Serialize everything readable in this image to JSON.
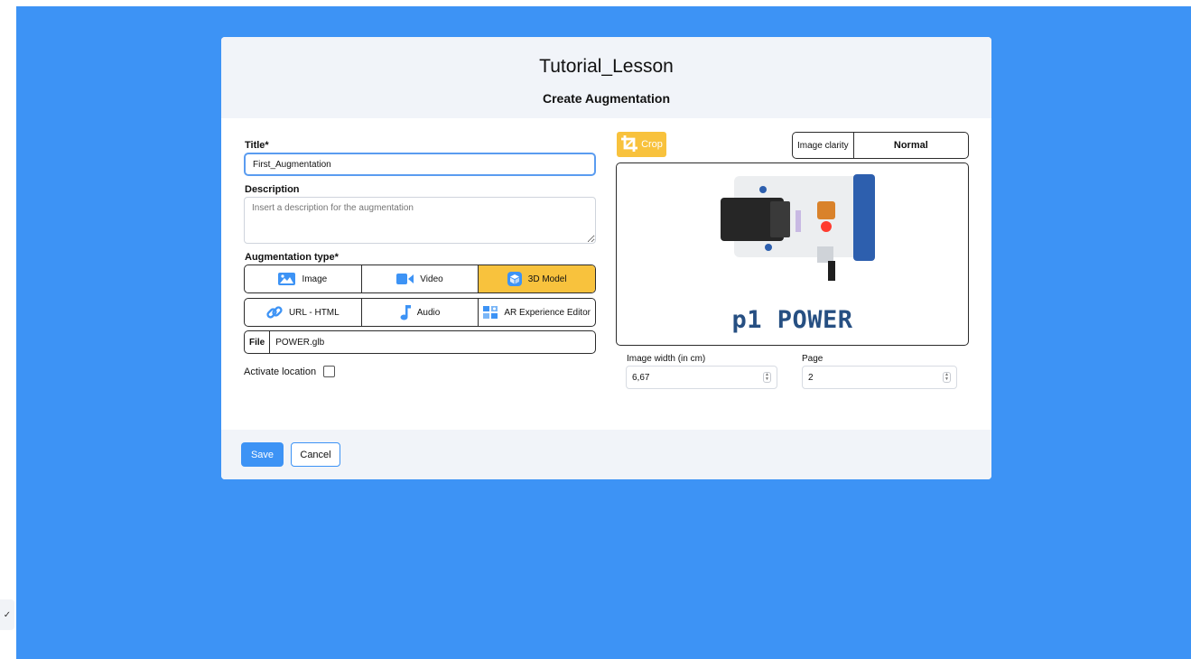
{
  "lesson": {
    "title": "Tutorial_Lesson"
  },
  "modal": {
    "title": "Create Augmentation"
  },
  "form": {
    "title_label": "Title*",
    "title_value": "First_Augmentation",
    "description_label": "Description",
    "description_placeholder": "Insert a description for the augmentation",
    "augmentation_type_label": "Augmentation type*",
    "types": [
      {
        "label": "Image",
        "icon": "image-icon",
        "active": false
      },
      {
        "label": "Video",
        "icon": "video-camera-icon",
        "active": false
      },
      {
        "label": "3D Model",
        "icon": "cube-icon",
        "active": true
      },
      {
        "label": "URL - HTML",
        "icon": "link-icon",
        "active": false
      },
      {
        "label": "Audio",
        "icon": "music-note-icon",
        "active": false
      },
      {
        "label": "AR Experience Editor",
        "icon": "ar-editor-icon",
        "active": false
      }
    ],
    "file_label": "File",
    "file_name": "POWER.glb",
    "activate_location_label": "Activate location",
    "activate_location_checked": false
  },
  "preview": {
    "crop_label": "Crop",
    "clarity_label": "Image clarity",
    "clarity_value": "Normal",
    "image_caption": "p1 POWER",
    "width_label": "Image width (in cm)",
    "width_value": "6,67",
    "page_label": "Page",
    "page_value": "2"
  },
  "footer": {
    "save_label": "Save",
    "cancel_label": "Cancel"
  },
  "side_tab": {
    "glyph": "✓"
  },
  "colors": {
    "background": "#3d93f5",
    "accent": "#3d93f5",
    "active_type": "#f8c23d",
    "header_bg": "#f1f4f9",
    "caption_text": "#264f82"
  }
}
